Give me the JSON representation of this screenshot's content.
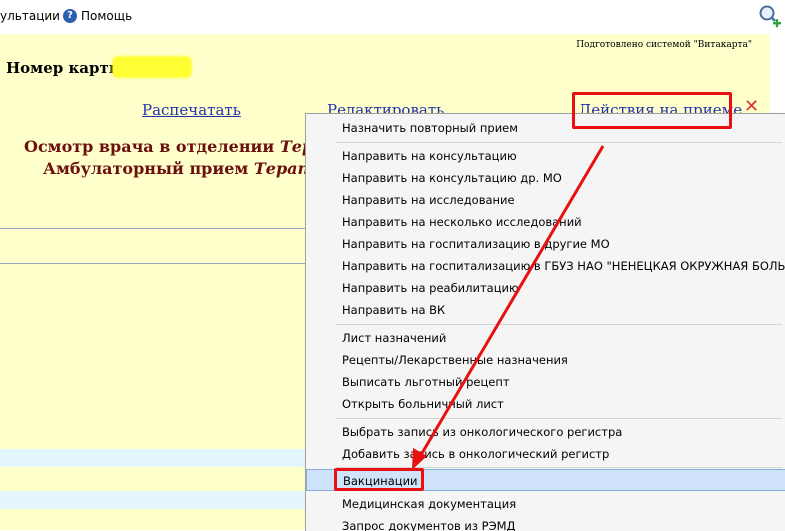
{
  "toolbar": {
    "consultations_label": "ультации",
    "help_label": "Помощь"
  },
  "document": {
    "prepared_by": "Подготовлено системой \"Витакарта\"",
    "card_number_label": "Номер карты:",
    "print_link": "Распечатать",
    "edit_link": "Редактировать",
    "actions_link": "Действия на приеме",
    "title_line1_prefix": "Осмотр врача в отделении ",
    "title_line1_italic": "Терапе",
    "title_line2_prefix": "Амбулаторный прием ",
    "title_line2_italic": "Терапевт"
  },
  "menu": {
    "items": [
      "Назначить повторный прием",
      "Направить на консультацию",
      "Направить на консультацию др. МО",
      "Направить на исследование",
      "Направить на несколько исследований",
      "Направить на госпитализацию в другие МО",
      "Направить на госпитализацию в ГБУЗ НАО \"НЕНЕЦКАЯ ОКРУЖНАЯ БОЛЬНИЦА",
      "Направить на реабилитацию",
      "Направить на ВК",
      "Лист назначений",
      "Рецепты/Лекарственные назначения",
      "Выписать льготный рецепт",
      "Открыть больничный лист",
      "Выбрать запись из онкологического регистра",
      "Добавить запись в онкологический регистр",
      "Вакцинации",
      "Медицинская документация",
      "Запрос документов из РЭМД"
    ],
    "selected": "Вакцинации"
  },
  "colors": {
    "annotation": "#e81010",
    "document_bg": "#ffffcc",
    "link": "#2233aa",
    "title": "#6b0f0f"
  }
}
